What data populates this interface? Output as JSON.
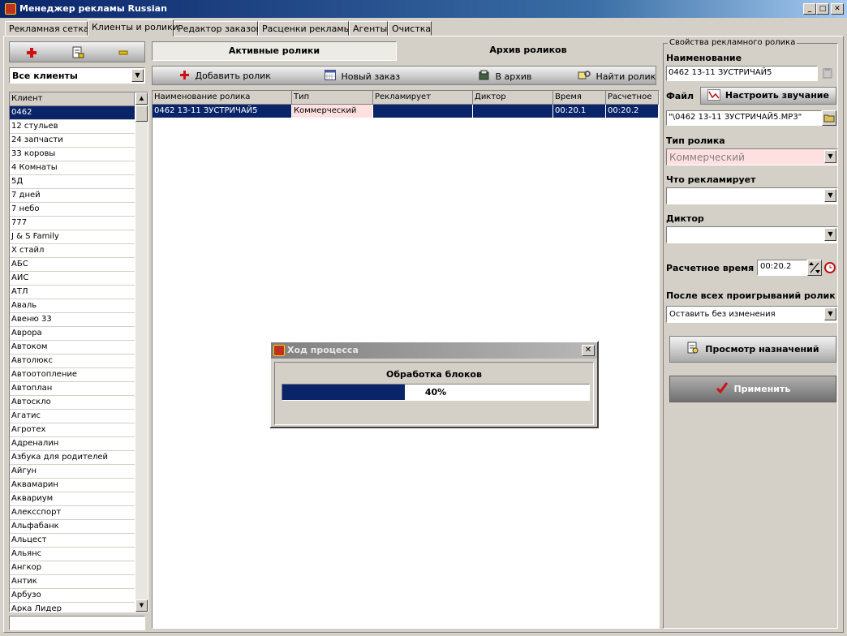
{
  "window": {
    "title": "Менеджер рекламы Russian"
  },
  "tabs": [
    "Рекламная сетка",
    "Клиенты и ролики",
    "Редактор заказов",
    "Расценки рекламы",
    "Агенты",
    "Очистка"
  ],
  "clients": {
    "filter_value": "Все клиенты",
    "column_header": "Клиент",
    "items": [
      "0462",
      "12 стульев",
      "24 запчасти",
      "33 коровы",
      "4 Комнаты",
      "5Д",
      "7 дней",
      "7 небо",
      "777",
      "J & S Family",
      "X стайл",
      "АБС",
      "АИС",
      "АТЛ",
      "Аваль",
      "Авеню 33",
      "Аврора",
      "Автоком",
      "Автолюкс",
      "Автоотопление",
      "Автоплан",
      "Автоскло",
      "Агатис",
      "Агротех",
      "Адреналин",
      "Азбука для родителей",
      "Айгун",
      "Аквамарин",
      "Аквариум",
      "Алексспорт",
      "Альфабанк",
      "Альцест",
      "Альянс",
      "Ангкор",
      "Антик",
      "Арбузо",
      "Арка Лидер"
    ]
  },
  "rolls": {
    "tab_active": "Активные ролики",
    "tab_archive": "Архив роликов",
    "toolbar": {
      "add": "Добавить ролик",
      "new_order": "Новый заказ",
      "archive": "В архив",
      "find": "Найти ролик"
    },
    "columns": [
      "Наименование ролика",
      "Тип",
      "Рекламирует",
      "Диктор",
      "Время",
      "Расчетное"
    ],
    "rows": [
      {
        "name": "0462 13-11 ЗУСТРИЧАЙ5",
        "type": "Коммерческий",
        "advertises": "",
        "speaker": "",
        "time": "00:20.1",
        "calc": "00:20.2"
      }
    ]
  },
  "props": {
    "group_title": "Свойства рекламного ролика",
    "name_label": "Наименование",
    "name_value": "0462 13-11 ЗУСТРИЧАЙ5",
    "file_label": "Файл",
    "sound_button": "Настроить звучание",
    "file_value": "\"\\0462 13-11 ЗУСТРИЧАЙ5.MP3\"",
    "type_label": "Тип ролика",
    "type_value": "Коммерческий",
    "advertises_label": "Что рекламирует",
    "advertises_value": "",
    "speaker_label": "Диктор",
    "speaker_value": "",
    "calc_time_label": "Расчетное время",
    "calc_time_value": "00:20.2",
    "after_label": "После всех проигрываний ролик",
    "after_value": "Оставить без изменения",
    "view_button": "Просмотр назначений",
    "apply_button": "Применить"
  },
  "progress_dialog": {
    "title": "Ход процесса",
    "message": "Обработка блоков",
    "percent_text": "40%",
    "percent": 40
  },
  "colors": {
    "title_bar": "#0a246a",
    "selection": "#0a246a",
    "type_pink": "#ffe0e0"
  }
}
